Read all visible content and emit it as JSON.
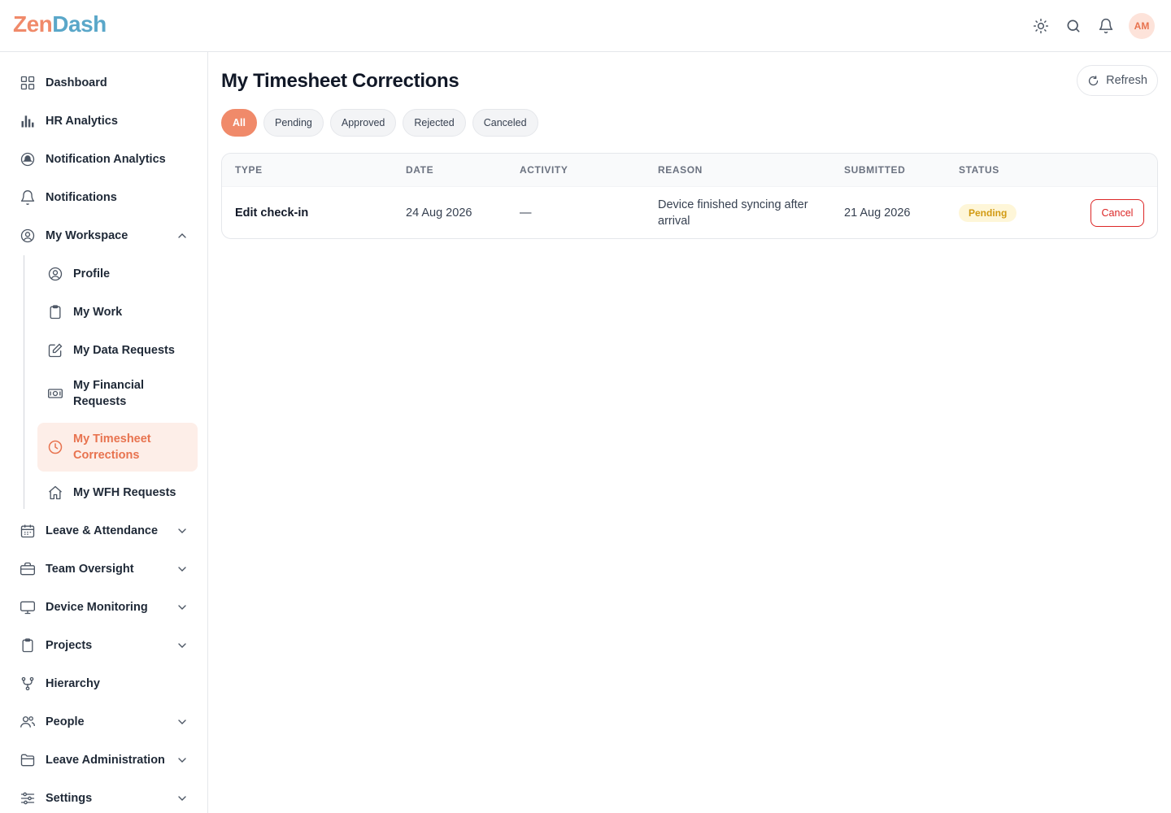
{
  "app": {
    "logo_zen": "Zen",
    "logo_dash": "Dash",
    "avatar_initials": "AM",
    "brand_color": "#f08a6a",
    "accent_color": "#e8734f"
  },
  "topbar": {
    "icons": [
      "sun-icon",
      "search-icon",
      "bell-icon"
    ]
  },
  "sidebar": {
    "items": [
      {
        "label": "Dashboard",
        "icon": "grid-icon"
      },
      {
        "label": "HR Analytics",
        "icon": "bar-chart-icon"
      },
      {
        "label": "Notification Analytics",
        "icon": "bell-analytics-icon"
      },
      {
        "label": "Notifications",
        "icon": "bell-icon"
      },
      {
        "label": "My Workspace",
        "icon": "user-circle-icon",
        "expanded": true
      },
      {
        "label": "Leave & Attendance",
        "icon": "calendar-icon"
      },
      {
        "label": "Team Oversight",
        "icon": "briefcase-icon"
      },
      {
        "label": "Device Monitoring",
        "icon": "monitor-icon"
      },
      {
        "label": "Projects",
        "icon": "clipboard-icon"
      },
      {
        "label": "Hierarchy",
        "icon": "hierarchy-icon"
      },
      {
        "label": "People",
        "icon": "users-icon"
      },
      {
        "label": "Leave Administration",
        "icon": "folder-icon"
      },
      {
        "label": "Settings",
        "icon": "sliders-icon"
      }
    ],
    "workspace_items": [
      {
        "label": "Profile",
        "icon": "user-circle-icon"
      },
      {
        "label": "My Work",
        "icon": "clipboard-icon"
      },
      {
        "label": "My Data Requests",
        "icon": "edit-icon"
      },
      {
        "label_line1": "My Financial",
        "label_line2": "Requests",
        "icon": "money-icon"
      },
      {
        "label_line1": "My Timesheet",
        "label_line2": "Corrections",
        "icon": "clock-icon",
        "active": true
      },
      {
        "label": "My WFH Requests",
        "icon": "home-icon"
      }
    ]
  },
  "main": {
    "title": "My Timesheet Corrections",
    "refresh_label": "Refresh",
    "filters": [
      {
        "label": "All",
        "active": true
      },
      {
        "label": "Pending"
      },
      {
        "label": "Approved"
      },
      {
        "label": "Rejected"
      },
      {
        "label": "Canceled"
      }
    ],
    "table": {
      "columns": [
        "TYPE",
        "DATE",
        "ACTIVITY",
        "REASON",
        "SUBMITTED",
        "STATUS"
      ],
      "rows": [
        {
          "type": "Edit check-in",
          "date": "24 Aug 2026",
          "activity": "—",
          "reason": "Device finished syncing after arrival",
          "submitted": "21 Aug 2026",
          "status": "Pending",
          "action": "Cancel"
        }
      ]
    }
  }
}
